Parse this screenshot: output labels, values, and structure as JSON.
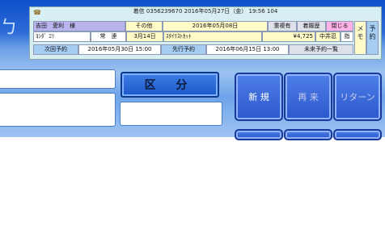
{
  "app": {
    "glyph": "ㄅ",
    "category_button": "区 分",
    "buttons": [
      {
        "label": "新 規",
        "state": "active"
      },
      {
        "label": "再 来",
        "state": "dim"
      },
      {
        "label": "リターン",
        "state": "dim"
      }
    ]
  },
  "popup": {
    "title": "着信 0356239670 2016年05月27日（金） 19:56 104",
    "row1": {
      "customer_name": "吉田　愛利　様",
      "category": "その他",
      "date": "2016年05月08日",
      "duplicate_label": "重複有",
      "history_label": "着履歴",
      "close_label": "閉じる"
    },
    "row2": {
      "kana": "ﾖｼﾀﾞ ｴﾘ",
      "customer_type": "常　連",
      "visit_day": "3月14日",
      "service": "ｽﾀｲﾘｽﾄｶｯﾄ",
      "price": "¥4,725",
      "staff": "中井忍",
      "nomination": "指"
    },
    "row3": {
      "next_label": "次回予約",
      "next_value": "2016年05月30日 15:00",
      "advance_label": "先行予約",
      "advance_value": "2016年06月15日 13:00",
      "future_list_label": "未来予約一覧"
    },
    "memo_label": "メモ",
    "reserve_label": "予約"
  }
}
